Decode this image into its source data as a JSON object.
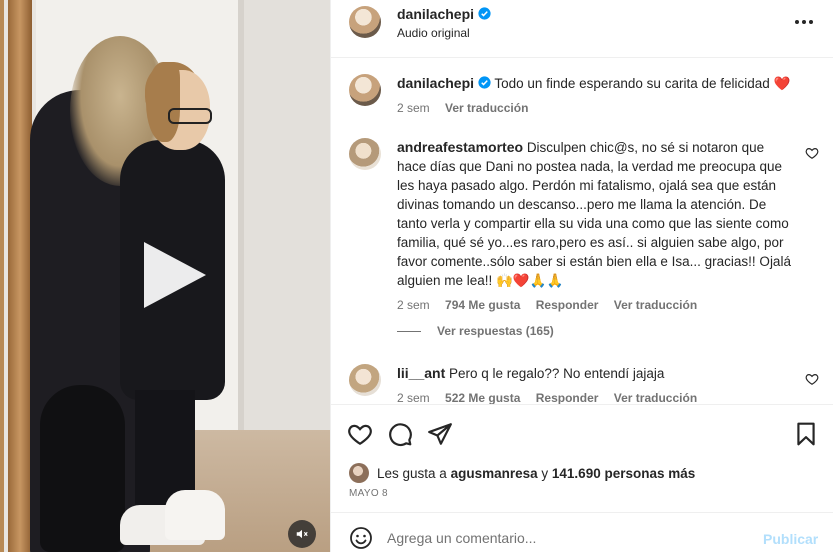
{
  "post": {
    "username": "danilachepi",
    "audio": "Audio original"
  },
  "caption": {
    "username": "danilachepi",
    "text": "Todo un finde esperando su carita de felicidad ❤️",
    "time": "2 sem",
    "translate": "Ver traducción"
  },
  "comments": [
    {
      "username": "andreafestamorteo",
      "text": "Disculpen chic@s, no sé si notaron que hace días que Dani no postea nada, la verdad me preocupa que les haya pasado algo. Perdón mi fatalismo, ojalá sea que están divinas tomando un descanso...pero me llama la atención. De tanto verla y compartir ella su vida una como que las siente como familia, qué sé yo...es raro,pero es así.. si alguien sabe algo, por favor comente..sólo saber si están bien ella e Isa... gracias!! Ojalá alguien me lea!! 🙌❤️🙏🙏",
      "time": "2 sem",
      "likes": "794 Me gusta",
      "reply": "Responder",
      "translate": "Ver traducción",
      "replies": "Ver respuestas (165)"
    },
    {
      "username": "lii__ant",
      "text": "Pero q le regalo?? No entendí jajaja",
      "time": "2 sem",
      "likes": "522 Me gusta",
      "reply": "Responder",
      "translate": "Ver traducción"
    }
  ],
  "likes_line": {
    "prefix": "Les gusta a",
    "user": "agusmanresa",
    "middle": "y",
    "others": "141.690 personas más"
  },
  "date": "MAYO 8",
  "composer": {
    "placeholder": "Agrega un comentario...",
    "publish": "Publicar"
  },
  "icons": {
    "like": "heart-icon",
    "comment": "comment-icon",
    "share": "share-icon",
    "save": "bookmark-icon",
    "more": "more-icon",
    "play": "play-icon",
    "mute": "mute-icon",
    "emoji": "emoji-icon",
    "verified": "verified-badge-icon"
  },
  "colors": {
    "verified": "#0095f6",
    "heart": "#ed4956",
    "publish_disabled": "#b2dffc",
    "secondary_text": "#737373"
  }
}
